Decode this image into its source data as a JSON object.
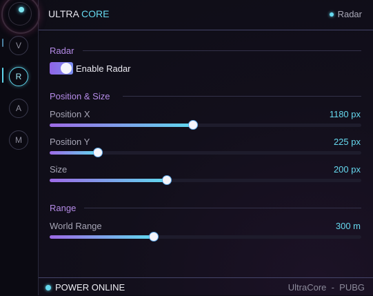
{
  "app": {
    "brand_primary": "ULTRA",
    "brand_accent": "CORE",
    "current_page": "Radar"
  },
  "sidebar": {
    "items": [
      {
        "label": "V",
        "active": false
      },
      {
        "label": "R",
        "active": true
      },
      {
        "label": "A",
        "active": false
      },
      {
        "label": "M",
        "active": false
      }
    ]
  },
  "radar_section": {
    "title": "Radar",
    "enable_label": "Enable Radar",
    "enabled": true
  },
  "position_section": {
    "title": "Position & Size",
    "sliders": [
      {
        "label": "Position X",
        "value_text": "1180 px",
        "fraction": 0.46
      },
      {
        "label": "Position Y",
        "value_text": "225 px",
        "fraction": 0.155
      },
      {
        "label": "Size",
        "value_text": "200 px",
        "fraction": 0.375
      }
    ]
  },
  "range_section": {
    "title": "Range",
    "sliders": [
      {
        "label": "World Range",
        "value_text": "300 m",
        "fraction": 0.335
      }
    ]
  },
  "footer": {
    "status": "POWER ONLINE",
    "right_text": "UltraCore  -  PUBG"
  },
  "colors": {
    "accent_cyan": "#66d9ef",
    "accent_purple": "#b58be8"
  }
}
